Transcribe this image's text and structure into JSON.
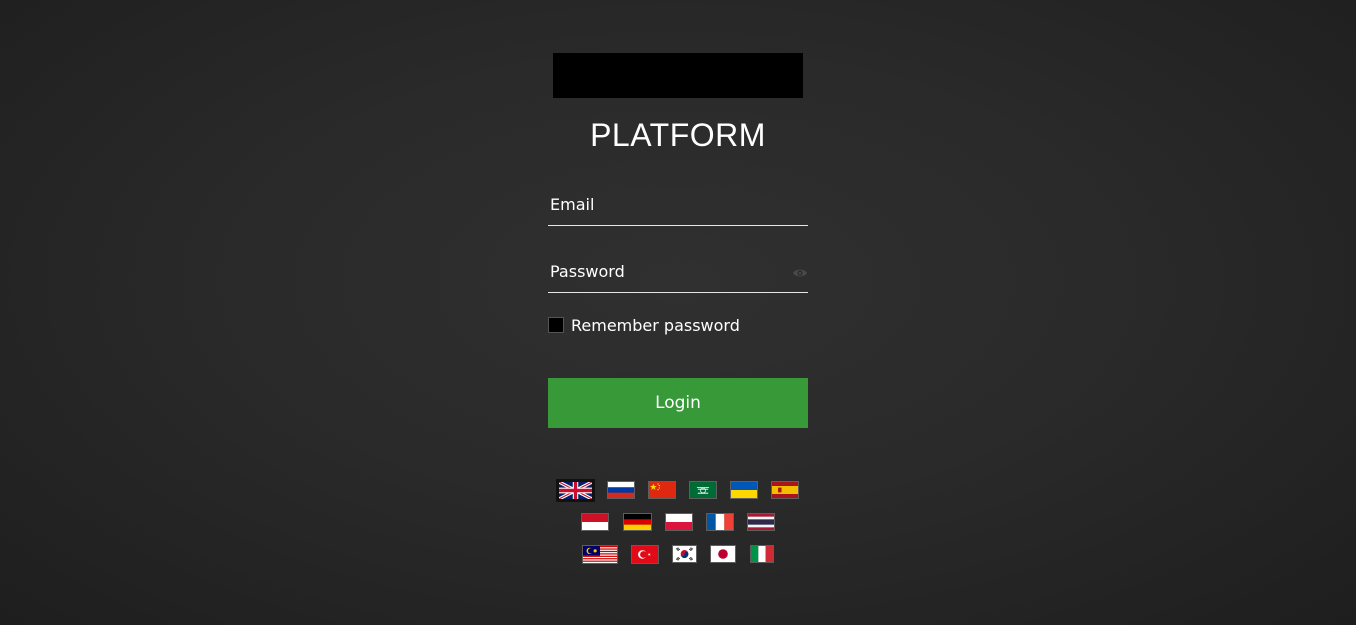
{
  "app": {
    "title": "PLATFORM"
  },
  "form": {
    "email_placeholder": "Email",
    "password_placeholder": "Password",
    "remember_label": "Remember password",
    "login_label": "Login"
  },
  "colors": {
    "background": "#2a2a2a",
    "login_button": "#379937",
    "text": "#ffffff"
  },
  "languages": [
    {
      "flag": "uk-flag-icon",
      "selected": true
    },
    {
      "flag": "russia-flag-icon"
    },
    {
      "flag": "china-flag-icon"
    },
    {
      "flag": "saudi-arabia-flag-icon"
    },
    {
      "flag": "ukraine-flag-icon"
    },
    {
      "flag": "spain-flag-icon"
    },
    {
      "flag": "indonesia-flag-icon"
    },
    {
      "flag": "germany-flag-icon"
    },
    {
      "flag": "poland-flag-icon"
    },
    {
      "flag": "france-flag-icon"
    },
    {
      "flag": "thailand-flag-icon"
    },
    {
      "flag": "malaysia-flag-icon"
    },
    {
      "flag": "turkey-flag-icon"
    },
    {
      "flag": "south-korea-flag-icon"
    },
    {
      "flag": "japan-flag-icon"
    },
    {
      "flag": "italy-flag-icon"
    }
  ]
}
